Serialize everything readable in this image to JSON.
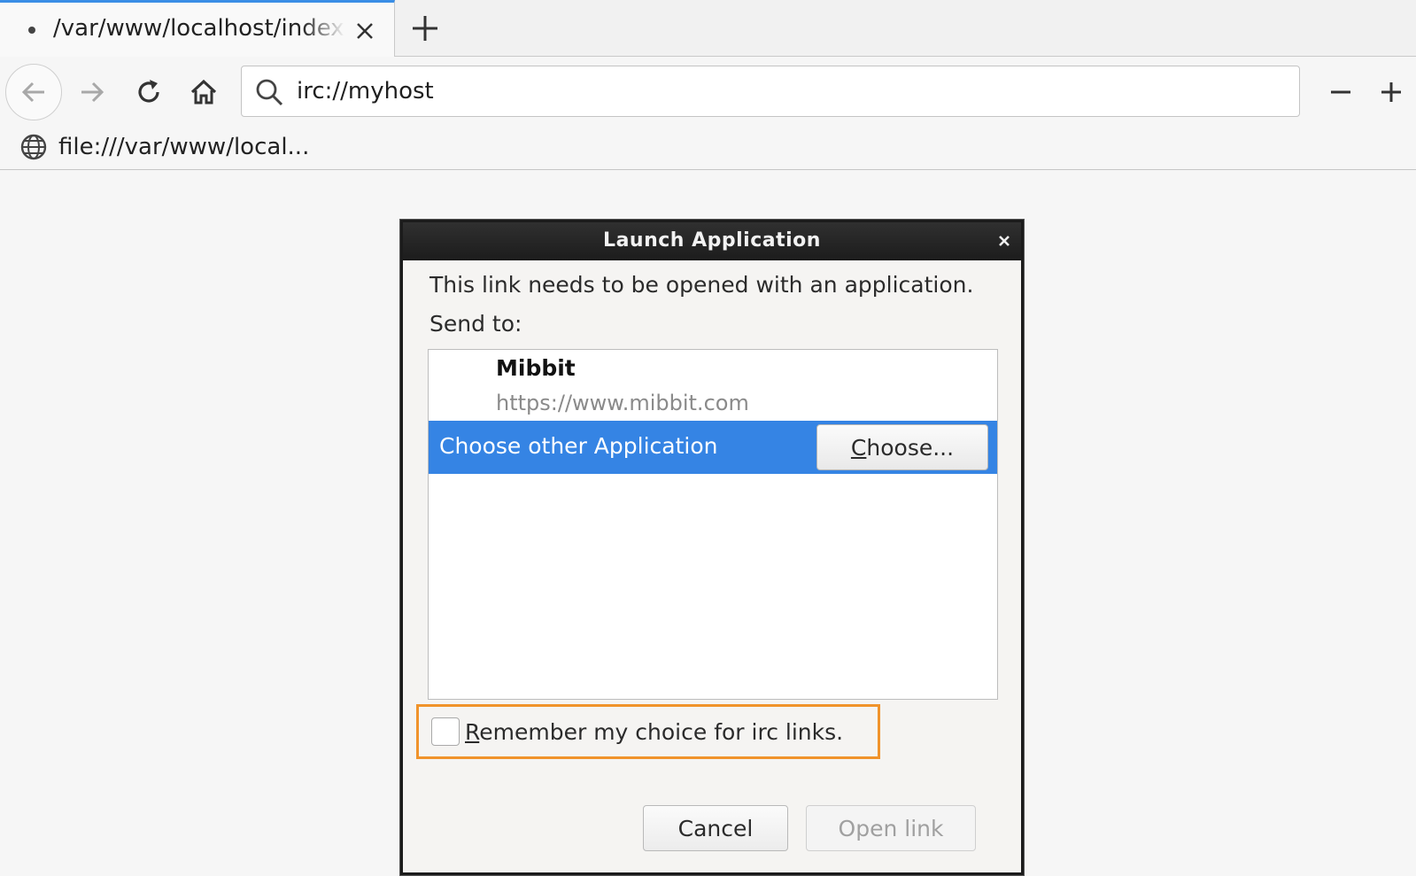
{
  "browser": {
    "tab": {
      "title": "/var/www/localhost/index",
      "close_icon": "close-icon"
    },
    "new_tab_icon": "plus-icon",
    "nav": {
      "back_icon": "arrow-left-icon",
      "forward_icon": "arrow-right-icon",
      "reload_icon": "reload-icon",
      "home_icon": "home-icon"
    },
    "urlbar": {
      "value": "irc://myhost",
      "icon": "search-icon"
    },
    "zoom": {
      "out_icon": "minus-icon",
      "in_icon": "plus-icon"
    },
    "bookmarks": [
      {
        "label": "file:///var/www/local...",
        "icon": "globe-icon"
      }
    ]
  },
  "dialog": {
    "title": "Launch Application",
    "close_icon": "close-icon",
    "message": "This link needs to be opened with an application.",
    "send_to_label": "Send to:",
    "apps": [
      {
        "name": "Mibbit",
        "url": "https://www.mibbit.com"
      }
    ],
    "choose_other_label": "Choose other Application",
    "choose_button": {
      "prefix": "",
      "accel": "C",
      "rest": "hoose..."
    },
    "remember": {
      "accel": "R",
      "rest": "emember my choice for irc links.",
      "checked": false
    },
    "cancel_label": "Cancel",
    "open_link_label": "Open link",
    "colors": {
      "selection": "#3584e4",
      "highlight_border": "#f0932b"
    }
  }
}
